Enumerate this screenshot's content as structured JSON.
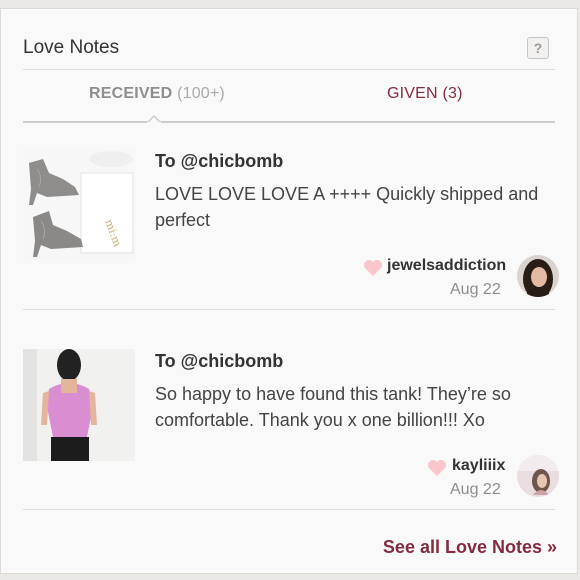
{
  "header": {
    "title": "Love Notes",
    "help_label": "?"
  },
  "tabs": [
    {
      "label": "RECEIVED",
      "count": "(100+)"
    },
    {
      "label": "GIVEN",
      "count": "(3)"
    }
  ],
  "notes": [
    {
      "to": "To @chicbomb",
      "message": "LOVE LOVE LOVE A ++++ Quickly shipped and perfect",
      "user": "jewelsaddiction",
      "date": "Aug 22"
    },
    {
      "to": "To @chicbomb",
      "message": "So happy to have found this tank! They’re so comfortable. Thank you x one billion!!! Xo",
      "user": "kayliiix",
      "date": "Aug 22"
    }
  ],
  "footer": {
    "see_all_label": "See all Love Notes »"
  },
  "colors": {
    "accent": "#822d3f",
    "heart": "#f8c6cc",
    "tab_inactive": "#8e8e8e"
  },
  "icons": {
    "help": "help-icon",
    "heart": "heart-icon",
    "caret": "caret-up-icon"
  }
}
